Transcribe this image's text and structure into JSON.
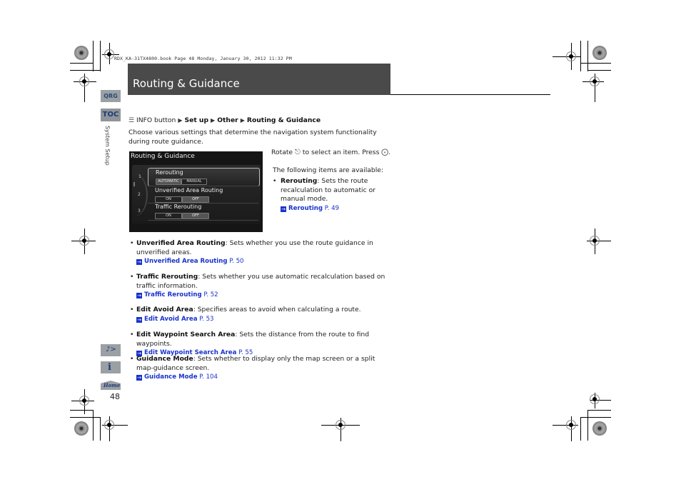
{
  "slug": "RDX_KA-31TX4800.book  Page 48  Monday, January 30, 2012  11:32 PM",
  "header": {
    "title": "Routing & Guidance"
  },
  "sidebar": {
    "qrg_label": "QRG",
    "toc_label": "TOC",
    "section_label": "System Setup",
    "icons": [
      "voice-command-icon",
      "info-icon",
      "home-icon"
    ],
    "home_label": "Home",
    "page_number": "48"
  },
  "breadcrumb": {
    "prefix": "INFO button",
    "items": [
      "Set up",
      "Other",
      "Routing & Guidance"
    ]
  },
  "intro": "Choose various settings that determine the navigation system functionality during route guidance.",
  "screen": {
    "title": "Routing & Guidance",
    "rows": [
      {
        "num": "1",
        "title": "Rerouting",
        "options": [
          "AUTOMATIC",
          "MANUAL"
        ],
        "selected": "AUTOMATIC"
      },
      {
        "num": "2",
        "title": "Unverified Area Routing",
        "options": [
          "ON",
          "OFF"
        ],
        "selected": "OFF"
      },
      {
        "num": "3",
        "title": "Traffic Rerouting",
        "options": [
          "ON",
          "OFF"
        ],
        "selected": "OFF"
      }
    ]
  },
  "instruction": {
    "rotate": "Rotate",
    "select_text": "to select an item. Press",
    "end": "."
  },
  "available_label": "The following items are available:",
  "items": [
    {
      "term": "Rerouting",
      "desc": ": Sets the route recalculation to automatic or manual mode.",
      "link": "Rerouting",
      "page": "P. 49"
    },
    {
      "term": "Unverified Area Routing",
      "desc": ": Sets whether you use the route guidance in unverified areas.",
      "link": "Unverified Area Routing",
      "page": "P. 50"
    },
    {
      "term": "Traffic Rerouting",
      "desc": ": Sets whether you use automatic recalculation based on traffic information.",
      "link": "Traffic Rerouting",
      "page": "P. 52"
    },
    {
      "term": "Edit Avoid Area",
      "desc": ": Specifies areas to avoid when calculating a route.",
      "link": "Edit Avoid Area",
      "page": "P. 53"
    },
    {
      "term": "Edit Waypoint Search Area",
      "desc": ": Sets the distance from the route to find waypoints.",
      "link": "Edit Waypoint Search Area",
      "page": "P. 55"
    },
    {
      "term": "Guidance Mode",
      "desc": ": Sets whether to display only the map screen or a split map-guidance screen.",
      "link": "Guidance Mode",
      "page": "P. 104"
    }
  ]
}
